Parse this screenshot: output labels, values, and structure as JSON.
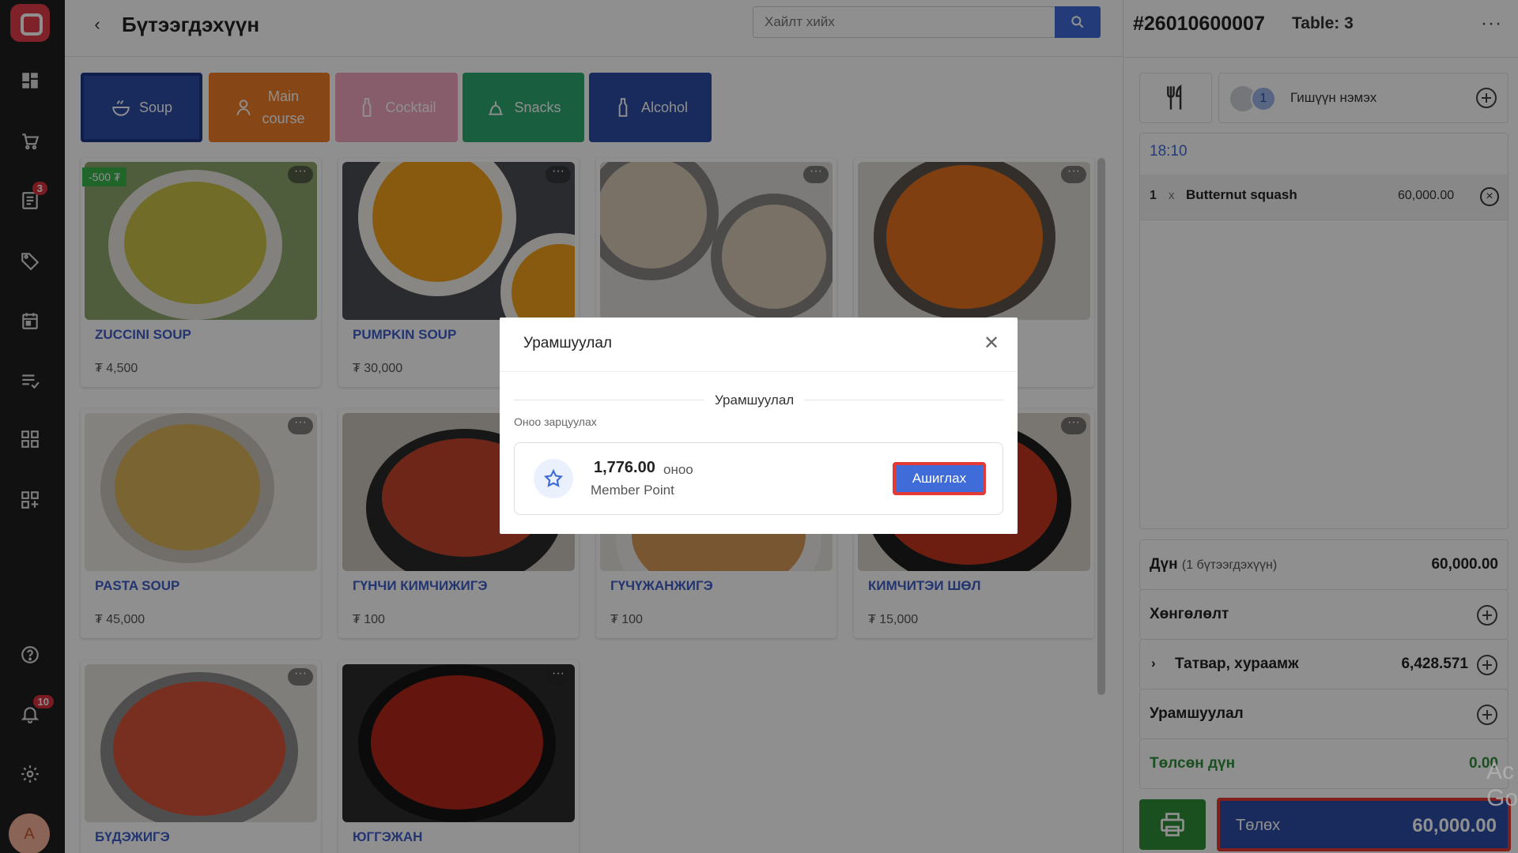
{
  "header": {
    "title": "Бүтээгдэхүүн",
    "search_placeholder": "Хайлт хийх"
  },
  "rail": {
    "items": [
      "dashboard-icon",
      "cart-icon",
      "orders-icon",
      "tag-icon",
      "calendar-icon",
      "list-icon",
      "grid-icon",
      "apps-add-icon",
      "help-icon",
      "bell-icon",
      "settings-icon"
    ],
    "orders_badge": "3",
    "bell_badge": "10",
    "avatar": "A"
  },
  "categories": [
    {
      "label": "Soup",
      "color": "#2e4ea5",
      "icon": "soup-icon"
    },
    {
      "label": "Main\ncourse",
      "color": "#f07e27",
      "icon": "chef-icon"
    },
    {
      "label": "Cocktail",
      "color": "#f0a6c0",
      "icon": "bottle-icon"
    },
    {
      "label": "Snacks",
      "color": "#2ea870",
      "icon": "snack-icon"
    },
    {
      "label": "Alcohol",
      "color": "#2e4ea5",
      "icon": "bottle-icon"
    }
  ],
  "products": [
    {
      "name": "ZUCCINI SOUP",
      "price": "₮ 4,500",
      "discount": "-500 ₮",
      "color": "#c9c34a"
    },
    {
      "name": "PUMPKIN SOUP",
      "price": "₮ 30,000",
      "color": "#f1a11e"
    },
    {
      "name": "",
      "price": "",
      "color": "#d8c9b4"
    },
    {
      "name": "",
      "price": "",
      "color": "#e2701e"
    },
    {
      "name": "PASTA SOUP",
      "price": "₮ 45,000",
      "color": "#d9b25a"
    },
    {
      "name": "ГҮНЧИ КИМЧИЖИГЭ",
      "price": "₮ 100",
      "color": "#c2452a"
    },
    {
      "name": "ГҮЧҮЖАНЖИГЭ",
      "price": "₮ 100",
      "color": "#d79a58"
    },
    {
      "name": "КИМЧИТЭИ ШӨЛ",
      "price": "₮ 15,000",
      "color": "#c5371f"
    },
    {
      "name": "БҮДЭЖИГЭ",
      "price": "",
      "color": "#d7553a"
    },
    {
      "name": "ЮГГЭЖАН",
      "price": "",
      "color": "#b3261a"
    }
  ],
  "order": {
    "number": "#26010600007",
    "table": "Table: 3",
    "guest_count": "1",
    "guest_label": "Гишүүн нэмэх",
    "time": "18:10",
    "lines": [
      {
        "qty": "1",
        "x": "x",
        "name": "Butternut squash",
        "price": "60,000.00"
      }
    ],
    "total_label": "Дүн",
    "total_sub": "(1 бүтээгдэхүүн)",
    "total_value": "60,000.00",
    "discount_label": "Хөнгөлөлт",
    "tax_label": "Татвар, хураамж",
    "tax_value": "6,428.571",
    "promo_label": "Урамшуулал",
    "paid_label": "Төлсөн дүн",
    "paid_value": "0.00",
    "pay_label": "Төлөх",
    "pay_amount": "60,000.00",
    "watermark": "Ac\nGo"
  },
  "modal": {
    "title": "Урамшуулал",
    "section": "Урамшуулал",
    "subtitle": "Оноо зарцуулах",
    "points_value": "1,776.00",
    "points_unit": "оноо",
    "points_label": "Member Point",
    "use_button": "Ашиглах"
  }
}
